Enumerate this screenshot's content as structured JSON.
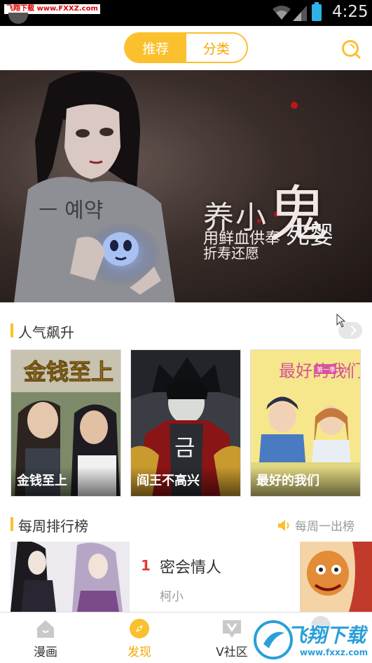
{
  "status_bar": {
    "watermark": "飞翔下载 www.FXXZ.com",
    "time": "4:25"
  },
  "header": {
    "tabs": [
      {
        "label": "推荐",
        "active": true
      },
      {
        "label": "分类",
        "active": false
      }
    ],
    "search_icon": "search-icon"
  },
  "banner": {
    "title_part1": "养",
    "title_part2": "小",
    "title_part3": "鬼",
    "subtitle_line1": "用鲜血供奉",
    "subtitle_emphasis": "死婴",
    "subtitle_line2": "折寿还愿",
    "dots": 6,
    "active_dot": 1
  },
  "popular": {
    "title": "人气飙升",
    "items": [
      {
        "label": "金钱至上",
        "cover_text": "金钱至上"
      },
      {
        "label": "阎王不高兴",
        "cover_text": "금"
      },
      {
        "label": "最好的我们",
        "cover_text": "最好的我们",
        "cover_tag": "第一季",
        "cover_num": "01"
      }
    ]
  },
  "weekly": {
    "title": "每周排行榜",
    "right_label": "每周一出榜",
    "items": [
      {
        "rank": "1",
        "title": "密会情人",
        "author": "柯小"
      }
    ]
  },
  "bottom_nav": {
    "items": [
      {
        "label": "漫画",
        "icon": "home-icon",
        "active": false
      },
      {
        "label": "发现",
        "icon": "compass-icon",
        "active": true
      },
      {
        "label": "V社区",
        "icon": "v-community-icon",
        "active": false
      }
    ]
  },
  "watermark": {
    "brand": "飞翔下载",
    "url": "www.fxxz.com"
  },
  "colors": {
    "accent": "#fbc02d",
    "rank_red": "#e53935",
    "status_bar": "#000000"
  }
}
